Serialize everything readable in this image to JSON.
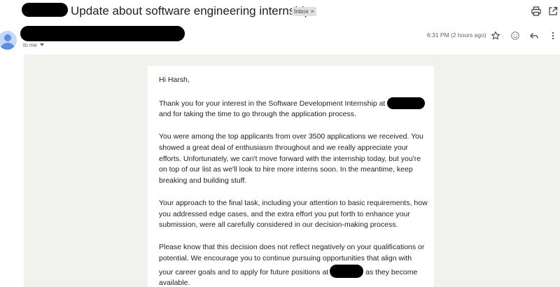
{
  "header": {
    "subject": "Update about software engineering internship",
    "label": "Inbox",
    "label_remove": "×"
  },
  "sender": {
    "recipient_line": "to me",
    "timestamp": "6:31 PM (2 hours ago)"
  },
  "message": {
    "greeting": "Hi Harsh,",
    "p1a": "Thank you for your interest in the Software Development Internship at",
    "p1b": "and for taking the time to go through the application process.",
    "p2": "You were among the top applicants from over 3500 applications we received. You showed a great deal of enthusiasm throughout and we really appreciate your efforts. Unfortunately, we can't move forward with the internship today, but you're on top of our list as we'll look to hire more interns soon. In the meantime, keep breaking and building stuff.",
    "p3": "Your approach to the final task, including your attention to basic requirements, how you addressed edge cases, and the extra effort you put forth to enhance your submission, were all carefully considered in our decision-making process.",
    "p4a": "Please know that this decision does not reflect negatively on your qualifications or potential. We encourage you to continue pursuing opportunities that align with your career goals and to apply for future positions at",
    "p4b": "as they become available."
  },
  "icons": {
    "print": "print-icon",
    "open_new_window": "open-in-new-window-icon",
    "star": "star-icon",
    "emoji": "emoji-reaction-icon",
    "reply": "reply-icon",
    "more": "more-vertical-icon",
    "avatar": "default-avatar-icon"
  },
  "colors": {
    "message_background": "#f1f1ee",
    "label_chip": "#e0e0e0",
    "avatar": "#5b8ee8",
    "redaction": "#000000"
  }
}
